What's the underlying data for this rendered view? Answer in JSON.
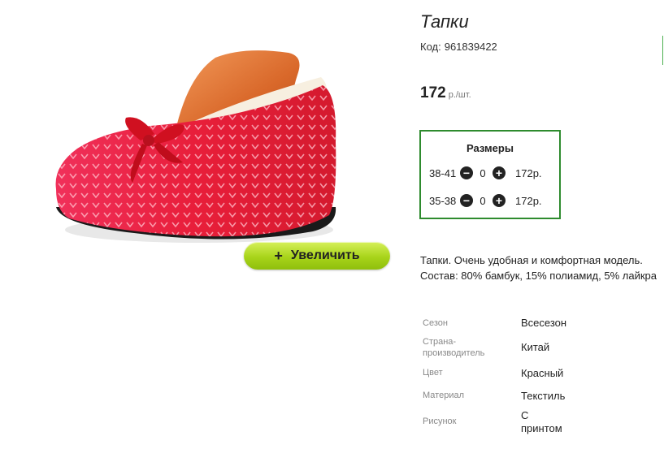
{
  "product": {
    "title": "Тапки",
    "sku_label": "Код:",
    "sku_value": "961839422",
    "price": "172",
    "price_unit": "р./шт.",
    "zoom_button_label": "Увеличить",
    "zoom_icon": "plus-icon"
  },
  "sizes": {
    "title": "Размеры",
    "rows": [
      {
        "size": "38-41",
        "qty": "0",
        "price": "172р."
      },
      {
        "size": "35-38",
        "qty": "0",
        "price": "172р."
      }
    ]
  },
  "description": "Тапки. Очень удобная и комфортная модель. Состав: 80% бамбук, 15% полиамид, 5% лайкра",
  "specs": [
    {
      "label": "Сезон",
      "value": "Всесезон"
    },
    {
      "label": "Страна-производитель",
      "value": "Китай"
    },
    {
      "label": "Цвет",
      "value": "Красный"
    },
    {
      "label": "Материал",
      "value": "Текстиль"
    },
    {
      "label": "Рисунок",
      "value": "С принтом"
    }
  ],
  "colors": {
    "accent_green": "#2e8b2e",
    "button_green": "#a8d41a"
  }
}
